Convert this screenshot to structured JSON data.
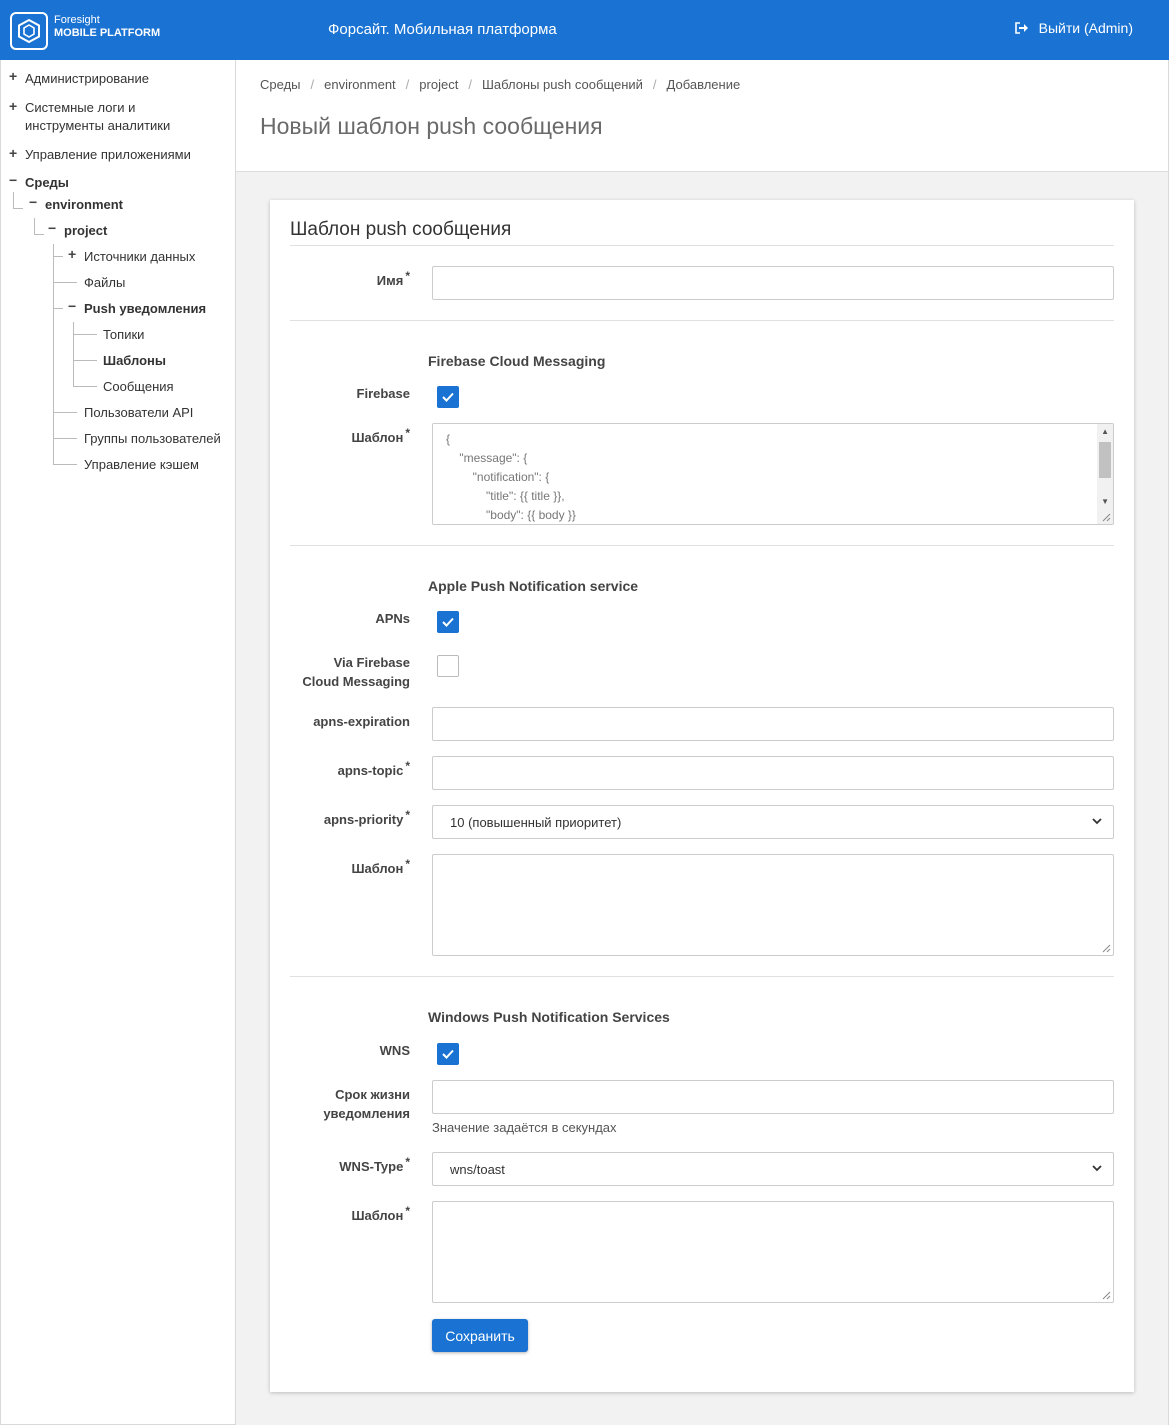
{
  "header": {
    "brand_top": "Foresight",
    "brand_bottom": "MOBILE PLATFORM",
    "app_title": "Форсайт. Мобильная платформа",
    "logout_label": "Выйти (Admin)",
    "color": "#1a73d2"
  },
  "sidebar": {
    "admin": "Администрирование",
    "logs_line1": "Системные логи и",
    "logs_line2": "инструменты аналитики",
    "apps": "Управление приложениями",
    "envs": "Среды",
    "environment": "environment",
    "project": "project",
    "datasources": "Источники данных",
    "files": "Файлы",
    "push": "Push уведомления",
    "topics": "Топики",
    "templates": "Шаблоны",
    "messages": "Сообщения",
    "api_users": "Пользователи API",
    "user_groups": "Группы пользователей",
    "cache": "Управление кэшем"
  },
  "breadcrumb": {
    "items": [
      "Среды",
      "environment",
      "project",
      "Шаблоны push сообщений",
      "Добавление"
    ],
    "separator": "/"
  },
  "page_title": "Новый шаблон push сообщения",
  "form": {
    "title": "Шаблон push сообщения",
    "name_label": "Имя",
    "required_mark": "*",
    "fcm": {
      "section": "Firebase Cloud Messaging",
      "checkbox_label": "Firebase",
      "checked": true,
      "template_label": "Шаблон",
      "template_value": "{\n    \"message\": {\n        \"notification\": {\n            \"title\": {{ title }},\n            \"body\": {{ body }}"
    },
    "apns": {
      "section": "Apple Push Notification service",
      "checkbox_label": "APNs",
      "checked": true,
      "via_line1": "Via Firebase",
      "via_line2": "Cloud Messaging",
      "via_checked": false,
      "expiration_label": "apns-expiration",
      "topic_label": "apns-topic",
      "priority_label": "apns-priority",
      "priority_value": "10 (повышенный приоритет)",
      "template_label": "Шаблон"
    },
    "wns": {
      "section": "Windows Push Notification Services",
      "checkbox_label": "WNS",
      "checked": true,
      "ttl_line1": "Срок жизни",
      "ttl_line2": "уведомления",
      "ttl_hint": "Значение задаётся в секундах",
      "type_label": "WNS-Type",
      "type_value": "wns/toast",
      "template_label": "Шаблон"
    },
    "save_label": "Сохранить"
  }
}
